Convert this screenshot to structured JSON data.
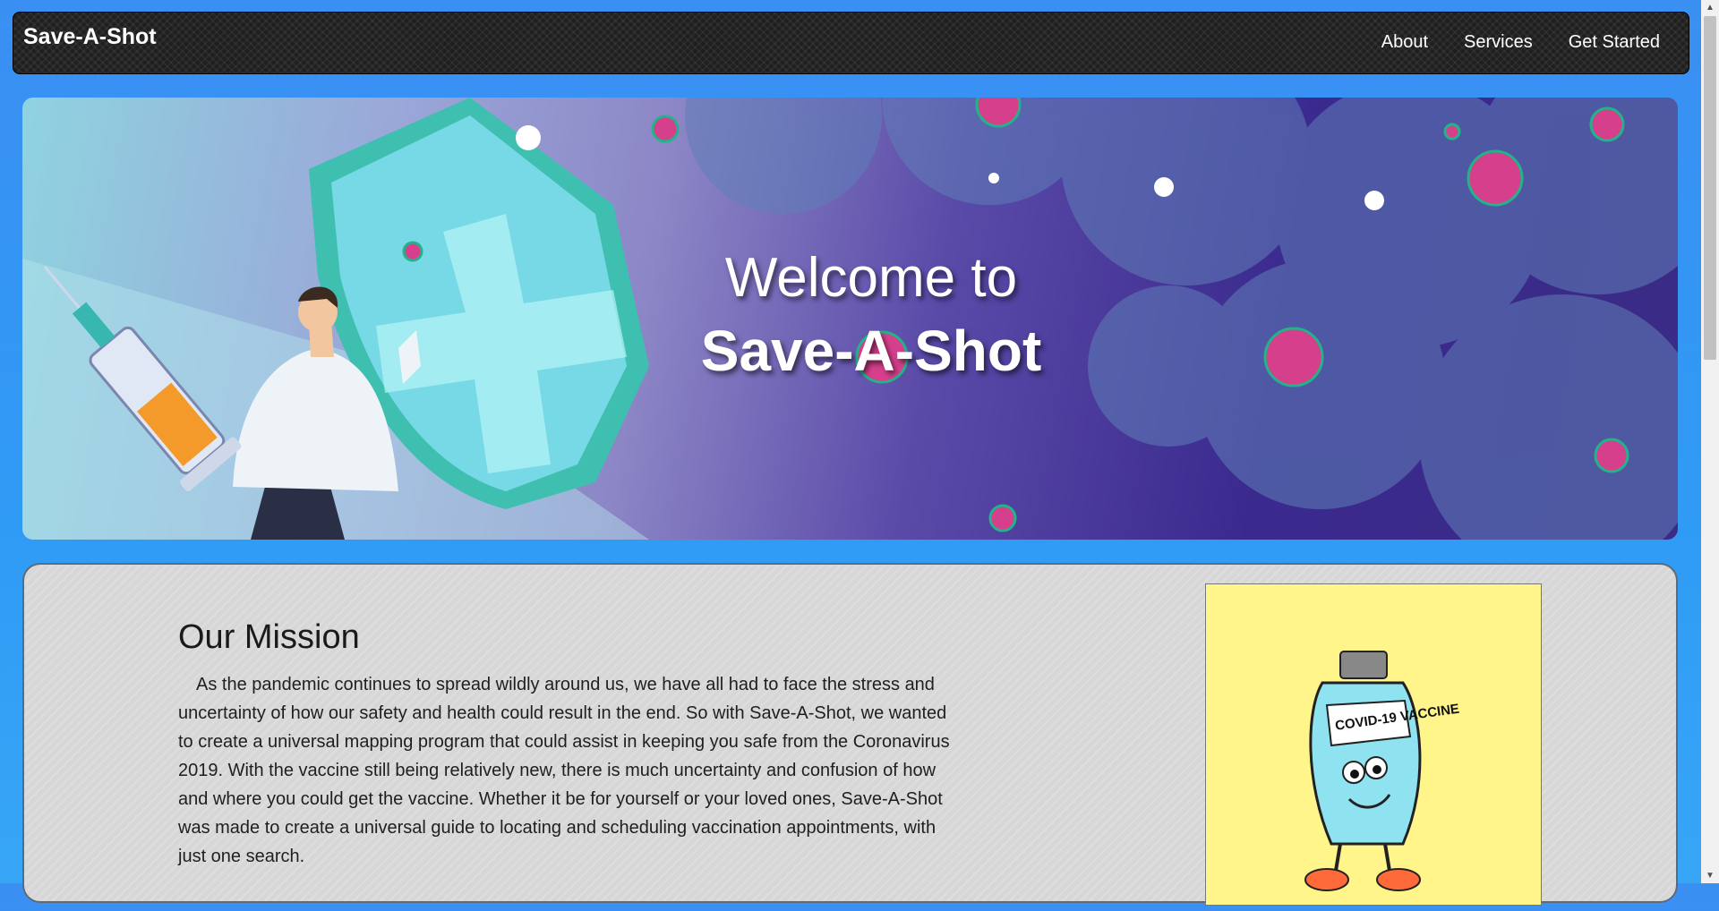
{
  "navbar": {
    "brand": "Save-A-Shot",
    "links": [
      "About",
      "Services",
      "Get Started"
    ]
  },
  "hero": {
    "line1": "Welcome to",
    "line2": "Save-A-Shot"
  },
  "mission": {
    "heading": "Our Mission",
    "body": "As the pandemic continues to spread wildly around us, we have all had to face the stress and uncertainty of how our safety and health could result in the end. So with Save-A-Shot, we wanted to create a universal mapping program that could assist in keeping you safe from the Coronavirus 2019. With the vaccine still being relatively new, there is much uncertainty and confusion of how and where you could get the vaccine. Whether it be for yourself or your loved ones, Save-A-Shot was made to create a universal guide to locating and scheduling vaccination appointments, with just one search.",
    "image_label": "COVID-19 VACCINE"
  },
  "colors": {
    "page_bg": "#3a8ff3",
    "navbar_bg": "#1f1f1f",
    "mission_bg": "#d7d7d7",
    "vaccine_card_bg": "#fff58b"
  }
}
